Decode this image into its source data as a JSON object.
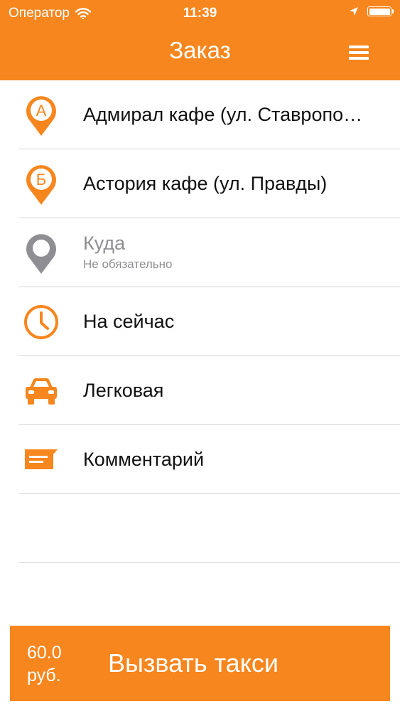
{
  "status_bar": {
    "carrier": "Оператор",
    "time": "11:39"
  },
  "navbar": {
    "title": "Заказ"
  },
  "rows": [
    {
      "icon": "pin-a-icon",
      "pin_letter": "А",
      "label": "Адмирал кафе (ул. Ставропо…"
    },
    {
      "icon": "pin-b-icon",
      "pin_letter": "Б",
      "label": "Астория кафе (ул. Правды)"
    },
    {
      "icon": "pin-gray-icon",
      "label": "Куда",
      "sublabel": "Не обязательно"
    },
    {
      "icon": "clock-icon",
      "label": "На сейчас"
    },
    {
      "icon": "car-icon",
      "label": "Легковая"
    },
    {
      "icon": "comment-icon",
      "label": "Комментарий"
    }
  ],
  "order_button": {
    "price_value": "60.0",
    "price_unit": "руб.",
    "label": "Вызвать такси"
  },
  "colors": {
    "accent": "#f7861e",
    "muted": "#8e8e93",
    "text": "#111111",
    "separator": "#d6d6d6"
  }
}
